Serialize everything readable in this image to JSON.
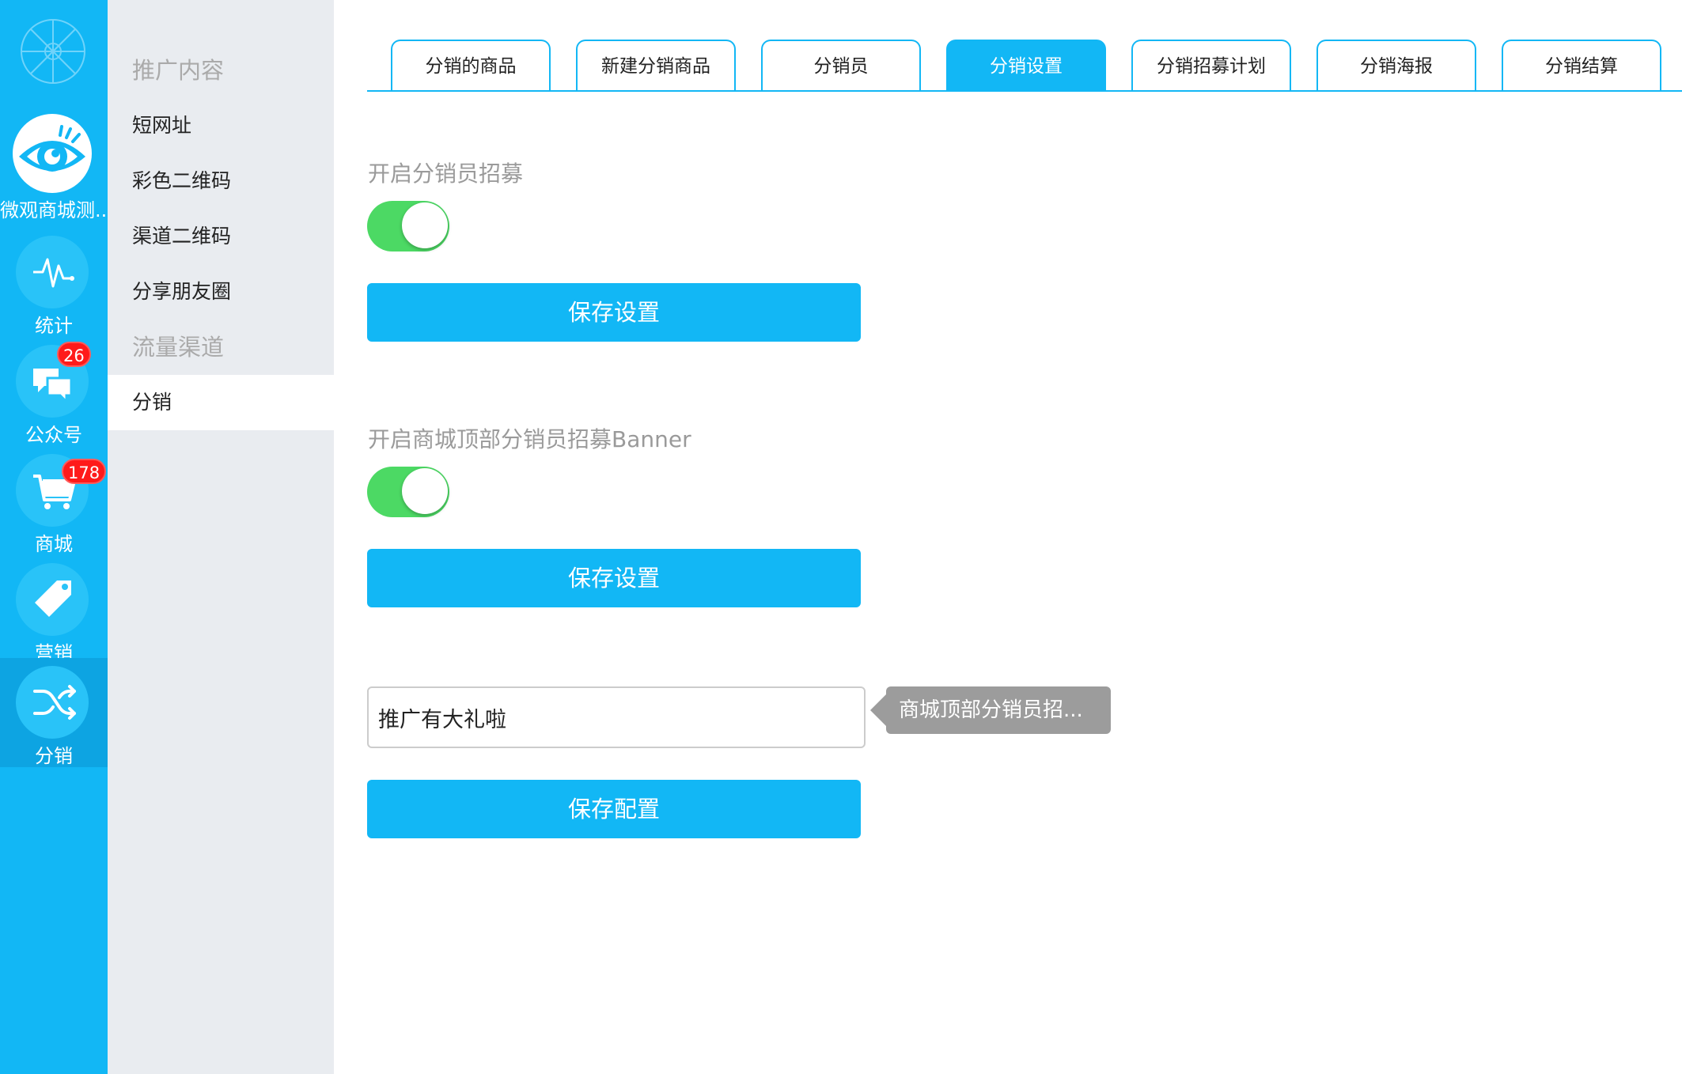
{
  "rail": {
    "items": [
      {
        "label": "微观商城测...",
        "icon": "eye-logo-icon"
      },
      {
        "label": "统计",
        "icon": "pulse-icon"
      },
      {
        "label": "公众号",
        "icon": "chat-bubbles-icon",
        "badge": "26"
      },
      {
        "label": "商城",
        "icon": "shopping-cart-icon",
        "badge": "178"
      },
      {
        "label": "营销",
        "icon": "price-tag-icon"
      },
      {
        "label": "分销",
        "icon": "shuffle-icon",
        "active": true
      }
    ],
    "accent_color": "#12b7f5",
    "badge_color": "#ff1a1a"
  },
  "subnav": {
    "heading1": "推广内容",
    "items1": [
      "短网址",
      "彩色二维码",
      "渠道二维码",
      "分享朋友圈"
    ],
    "heading2": "流量渠道",
    "items2": [
      "分销"
    ],
    "active_item": "分销"
  },
  "tabs": [
    {
      "label": "分销的商品"
    },
    {
      "label": "新建分销商品"
    },
    {
      "label": "分销员"
    },
    {
      "label": "分销设置",
      "active": true
    },
    {
      "label": "分销招募计划"
    },
    {
      "label": "分销海报"
    },
    {
      "label": "分销结算"
    }
  ],
  "settings": {
    "recruit_label": "开启分销员招募",
    "recruit_enabled": true,
    "save_label_1": "保存设置",
    "banner_label": "开启商城顶部分销员招募Banner",
    "banner_enabled": true,
    "save_label_2": "保存设置",
    "banner_text_value": "推广有大礼啦",
    "banner_text_tooltip": "商城顶部分销员招...",
    "save_config_label": "保存配置",
    "toggle_on_color": "#4cd964"
  }
}
